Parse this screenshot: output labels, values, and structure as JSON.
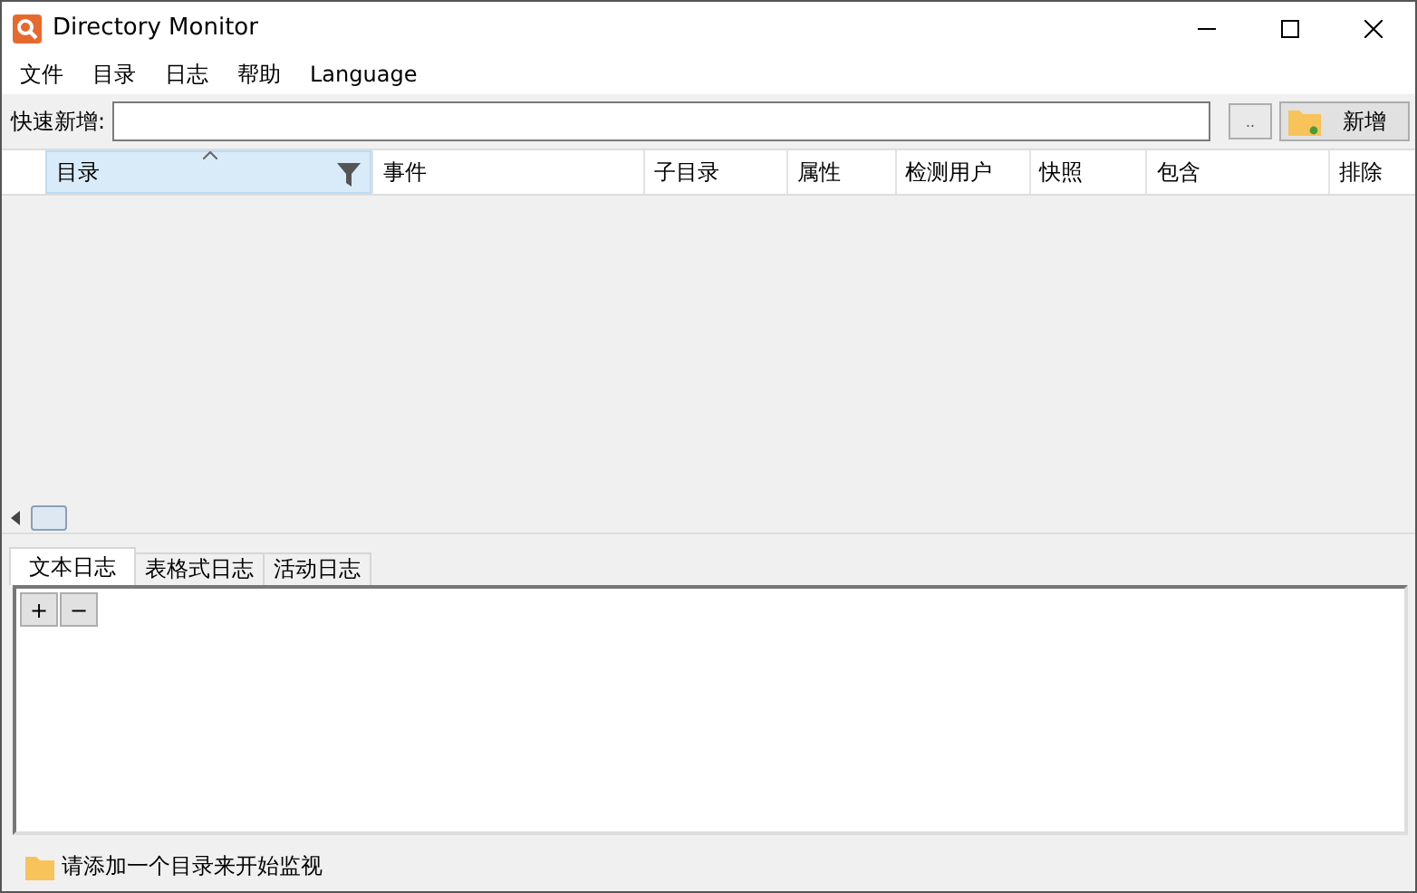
{
  "window": {
    "title": "Directory Monitor"
  },
  "menu": [
    "文件",
    "目录",
    "日志",
    "帮助",
    "Language"
  ],
  "quick_add": {
    "label": "快速新增:",
    "browse": "..",
    "add_button": "新增"
  },
  "table": {
    "columns": [
      {
        "label": "目录",
        "selected": true
      },
      {
        "label": "事件",
        "selected": false
      },
      {
        "label": "子目录",
        "selected": false
      },
      {
        "label": "属性",
        "selected": false
      },
      {
        "label": "检测用户",
        "selected": false
      },
      {
        "label": "快照",
        "selected": false
      },
      {
        "label": "包含",
        "selected": false
      },
      {
        "label": "排除",
        "selected": false
      }
    ]
  },
  "tabs": [
    {
      "label": "文本日志",
      "selected": true
    },
    {
      "label": "表格式日志",
      "selected": false
    },
    {
      "label": "活动日志",
      "selected": false
    }
  ],
  "log_buttons": [
    "+",
    "−"
  ],
  "status_bar": "请添加一个目录来开始监视"
}
